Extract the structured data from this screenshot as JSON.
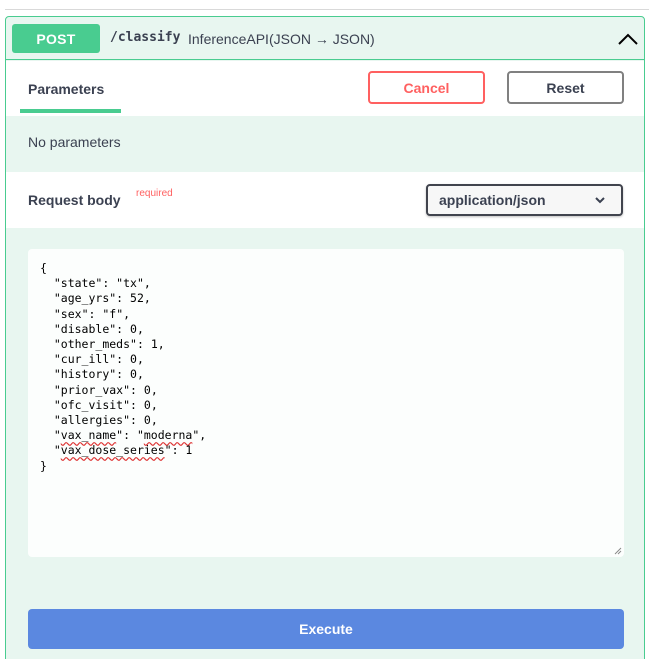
{
  "operation": {
    "method": "POST",
    "path": "/classify",
    "description": "InferenceAPI(JSON → JSON)",
    "method_color": "#49cc90"
  },
  "parameters": {
    "tab_label": "Parameters",
    "cancel_label": "Cancel",
    "reset_label": "Reset",
    "empty_text": "No parameters"
  },
  "request_body": {
    "label": "Request body",
    "required_label": "required",
    "content_type": "application/json",
    "code_lines": [
      {
        "pre": "{",
        "key": "",
        "mid": "",
        "val": "",
        "post": "",
        "squig_key": false,
        "squig_val": false
      },
      {
        "pre": "  \"",
        "key": "state",
        "mid": "\": \"",
        "val": "tx",
        "post": "\",",
        "squig_key": false,
        "squig_val": false
      },
      {
        "pre": "  \"",
        "key": "age_yrs",
        "mid": "\": ",
        "val": "52",
        "post": ",",
        "squig_key": false,
        "squig_val": false
      },
      {
        "pre": "  \"",
        "key": "sex",
        "mid": "\": \"",
        "val": "f",
        "post": "\",",
        "squig_key": false,
        "squig_val": false
      },
      {
        "pre": "  \"",
        "key": "disable",
        "mid": "\": ",
        "val": "0",
        "post": ",",
        "squig_key": false,
        "squig_val": false
      },
      {
        "pre": "  \"",
        "key": "other_meds",
        "mid": "\": ",
        "val": "1",
        "post": ",",
        "squig_key": false,
        "squig_val": false
      },
      {
        "pre": "  \"",
        "key": "cur_ill",
        "mid": "\": ",
        "val": "0",
        "post": ",",
        "squig_key": false,
        "squig_val": false
      },
      {
        "pre": "  \"",
        "key": "history",
        "mid": "\": ",
        "val": "0",
        "post": ",",
        "squig_key": false,
        "squig_val": false
      },
      {
        "pre": "  \"",
        "key": "prior_vax",
        "mid": "\": ",
        "val": "0",
        "post": ",",
        "squig_key": false,
        "squig_val": false
      },
      {
        "pre": "  \"",
        "key": "ofc_visit",
        "mid": "\": ",
        "val": "0",
        "post": ",",
        "squig_key": false,
        "squig_val": false
      },
      {
        "pre": "  \"",
        "key": "allergies",
        "mid": "\": ",
        "val": "0",
        "post": ",",
        "squig_key": false,
        "squig_val": false
      },
      {
        "pre": "  \"",
        "key": "vax_name",
        "mid": "\": \"",
        "val": "moderna",
        "post": "\",",
        "squig_key": true,
        "squig_val": true
      },
      {
        "pre": "  \"",
        "key": "vax_dose_series",
        "mid": "\": ",
        "val": "1",
        "post": "",
        "squig_key": true,
        "squig_val": false
      },
      {
        "pre": "}",
        "key": "",
        "mid": "",
        "val": "",
        "post": "",
        "squig_key": false,
        "squig_val": false
      }
    ]
  },
  "execute_label": "Execute"
}
